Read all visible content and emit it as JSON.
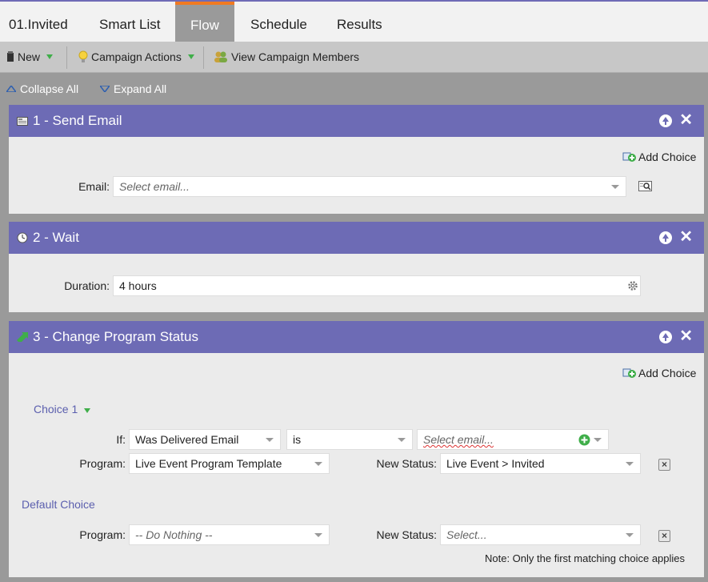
{
  "tabs": [
    {
      "label": "01.Invited"
    },
    {
      "label": "Smart List"
    },
    {
      "label": "Flow"
    },
    {
      "label": "Schedule"
    },
    {
      "label": "Results"
    }
  ],
  "toolbar": {
    "new_label": "New",
    "campaign_actions_label": "Campaign Actions",
    "view_members_label": "View Campaign Members"
  },
  "collapse": {
    "collapse_all": "Collapse All",
    "expand_all": "Expand All"
  },
  "steps": [
    {
      "title": "1 - Send Email",
      "add_choice": "Add Choice",
      "email_label": "Email:",
      "email_placeholder": "Select email..."
    },
    {
      "title": "2 - Wait",
      "duration_label": "Duration:",
      "duration_value": "4 hours"
    },
    {
      "title": "3 - Change Program Status",
      "add_choice": "Add Choice",
      "choice1_label": "Choice 1",
      "if_label": "If:",
      "if_value": "Was Delivered Email",
      "operator_value": "is",
      "email_placeholder": "Select email...",
      "program_label": "Program:",
      "program_value": "Live Event Program Template",
      "new_status_label": "New Status:",
      "new_status_value": "Live Event > Invited",
      "default_choice_label": "Default Choice",
      "default_program_label": "Program:",
      "default_program_value": "-- Do Nothing --",
      "default_status_label": "New Status:",
      "default_status_placeholder": "Select...",
      "note": "Note: Only the first matching choice applies"
    }
  ]
}
